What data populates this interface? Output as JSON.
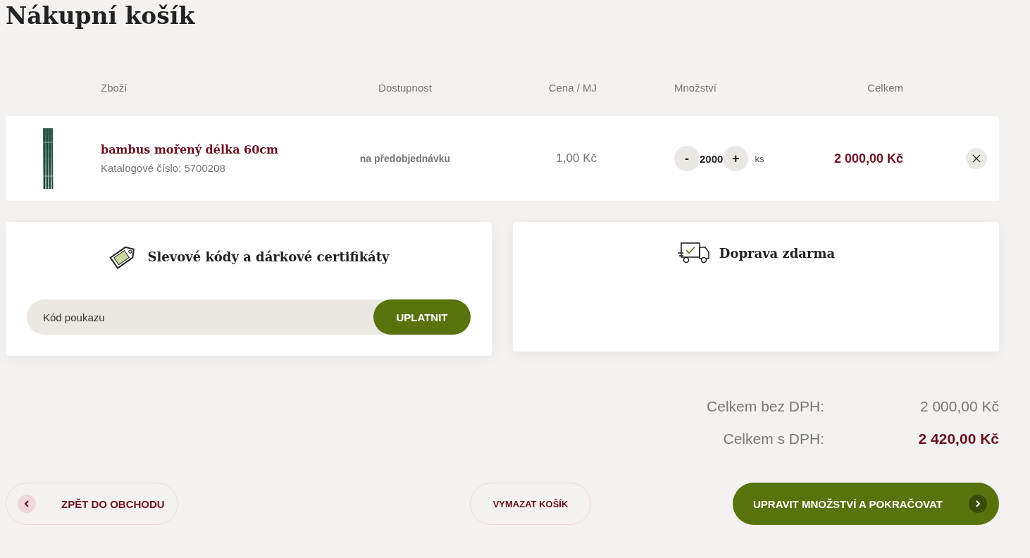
{
  "title": "Nákupní košík",
  "columns": [
    "Zboží",
    "Dostupnost",
    "Cena / MJ",
    "Množství",
    "Celkem"
  ],
  "items": [
    {
      "name": "bambus mořený délka 60cm",
      "catalog": "Katalogové číslo: 5700208",
      "availability": "na předobjednávku",
      "unit_price": "1,00 Kč",
      "minus": "-",
      "quantity": "2000",
      "plus": "+",
      "unit": "ks",
      "total": "2 000,00 Kč"
    }
  ],
  "voucher": {
    "title": "Slevové kódy a dárkové certifikáty",
    "placeholder": "Kód poukazu",
    "button": "UPLATNIT"
  },
  "shipping": {
    "title": "Doprava zdarma"
  },
  "totals": [
    {
      "label": "Celkem bez DPH:",
      "value": "2 000,00 Kč",
      "emphasis": false
    },
    {
      "label": "Celkem s DPH:",
      "value": "2 420,00 Kč",
      "emphasis": true
    }
  ],
  "actions": {
    "back": "ZPĚT DO OBCHODU",
    "clear": "VYMAZAT KOŠÍK",
    "continue": "UPRAVIT MNOŽSTVÍ A POKRAČOVAT"
  }
}
